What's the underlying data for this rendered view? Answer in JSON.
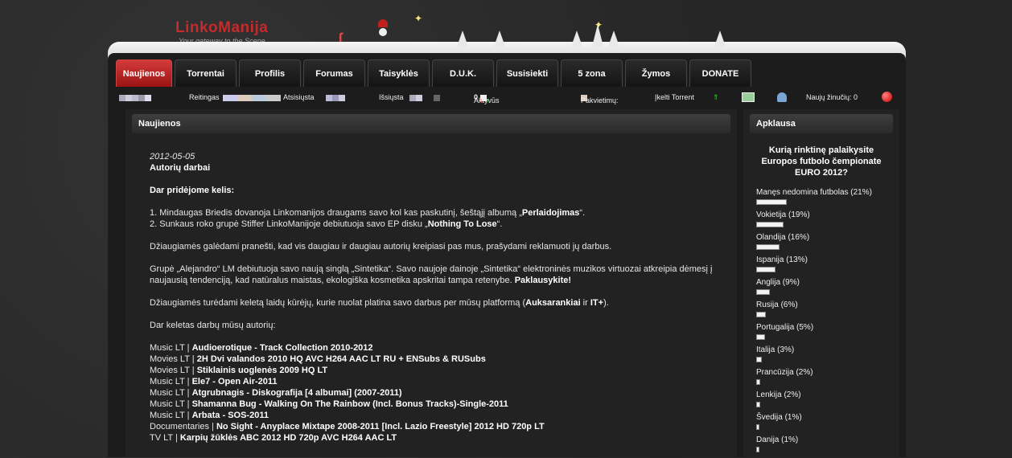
{
  "site": {
    "logo": "LinkoManija",
    "slogan": "Your gateway to the Scene"
  },
  "nav": [
    "Naujienos",
    "Torrentai",
    "Profilis",
    "Forumas",
    "Taisyklės",
    "D.U.K.",
    "Susisiekti",
    "5 zona",
    "Žymos",
    "DONATE"
  ],
  "status": {
    "rating": "Reitingas",
    "downloaded": "Atsisiųsta",
    "uploaded": "Išsiųsta",
    "active": "Aktyvūs",
    "active_count": "0",
    "invites": "Pakvietimų:",
    "upload_torrent": "Įkelti Torrent",
    "new_messages": "Naujų žinučių: 0"
  },
  "main": {
    "heading": "Naujienos",
    "date": "2012-05-05",
    "subtitle": "Autorių darbai",
    "added": "Dar pridėjome kelis:",
    "item1_pre": "1. Mindaugas Briedis dovanoja Linkomanijos draugams savo kol kas paskutinį, šeštąjį albumą „",
    "item1_bold": "Perlaidojimas",
    "item1_post": "“.",
    "item2_pre": "2. Sunkaus roko grupė Stiffer LinkoManijoje debiutuoja savo EP disku „",
    "item2_bold": "Nothing To Lose",
    "item2_post": "“.",
    "p_happy": "Džiaugiamės galėdami pranešti, kad vis daugiau ir daugiau autorių kreipiasi pas mus, prašydami reklamuoti jų darbus.",
    "p_group": "Grupė „Alejandro“ LM debiutuoja savo naują singlą „Sintetika“. Savo naujoje dainoje „Sintetika“ elektroninės muzikos virtuozai atkreipia dėmesį į naujausią tendenciją, kad natūralus maistas, ekologiška kosmetika apskritai tampa retenybe.",
    "p_group_bold": "Paklausykite!",
    "p_shows_pre": "Džiaugiamės turėdami keletą laidų kūrėjų, kurie nuolat platina savo darbus per mūsų platformą (",
    "p_shows_b1": "Auksarankiai",
    "p_shows_mid": " ir ",
    "p_shows_b2": "IT+",
    "p_shows_post": ").",
    "p_more": "Dar keletas darbų mūsų autorių:",
    "works": [
      {
        "cat": "Music LT | ",
        "title": "Audioerotique - Track Collection 2010-2012"
      },
      {
        "cat": "Movies LT | ",
        "title": "2H Dvi valandos 2010 HQ AVC H264 AAC LT RU + ENSubs & RUSubs"
      },
      {
        "cat": "Movies LT | ",
        "title": "Stiklainis uoglenės 2009 HQ LT"
      },
      {
        "cat": "Music LT | ",
        "title": "Ele7 - Open Air-2011"
      },
      {
        "cat": "Music LT | ",
        "title": "Atgrubnagis - Diskografija [4 albumai] (2007-2011)"
      },
      {
        "cat": "Music LT | ",
        "title": "Shamanna Bug - Walking On The Rainbow (Incl. Bonus Tracks)-Single-2011"
      },
      {
        "cat": "Music LT | ",
        "title": "Arbata - SOS-2011"
      },
      {
        "cat": "Documentaries | ",
        "title": "No Sight - Anyplace Mixtape 2008-2011 [Incl. Lazio Freestyle] 2012 HD 720p LT"
      },
      {
        "cat": "TV LT | ",
        "title": "Karpių žūklės ABC 2012 HD 720p AVC H264 AAC LT"
      }
    ]
  },
  "poll": {
    "heading": "Apklausa",
    "question": "Kurią rinktinę palaikysite Europos futbolo čempionate EURO 2012?",
    "options": [
      {
        "label": "Manęs nedomina futbolas (21%)",
        "pct": 21
      },
      {
        "label": "Vokietija (19%)",
        "pct": 19
      },
      {
        "label": "Olandija (16%)",
        "pct": 16
      },
      {
        "label": "Ispanija (13%)",
        "pct": 13
      },
      {
        "label": "Anglija (9%)",
        "pct": 9
      },
      {
        "label": "Rusija (6%)",
        "pct": 6
      },
      {
        "label": "Portugalija (5%)",
        "pct": 5
      },
      {
        "label": "Italija (3%)",
        "pct": 3
      },
      {
        "label": "Prancūzija (2%)",
        "pct": 2
      },
      {
        "label": "Lenkija (2%)",
        "pct": 2
      },
      {
        "label": "Švedija (1%)",
        "pct": 1
      },
      {
        "label": "Danija (1%)",
        "pct": 1
      }
    ]
  },
  "colors": {
    "accent": "#c62a2a",
    "tab_active": "#b82020"
  }
}
